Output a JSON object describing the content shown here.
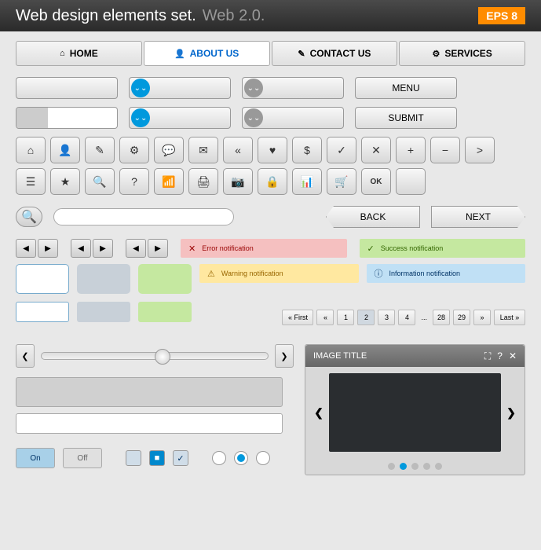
{
  "header": {
    "title": "Web design elements set.",
    "subtitle": "Web 2.0.",
    "badge": "EPS 8"
  },
  "nav": [
    {
      "icon": "⌂",
      "label": "HOME"
    },
    {
      "icon": "👤",
      "label": "ABOUT US",
      "active": true
    },
    {
      "icon": "✎",
      "label": "CONTACT US"
    },
    {
      "icon": "⚙",
      "label": "SERVICES"
    }
  ],
  "buttons": {
    "menu": "MENU",
    "submit": "SUBMIT",
    "back": "BACK",
    "next": "NEXT",
    "ok": "OK"
  },
  "icons": [
    "⌂",
    "👤",
    "✎",
    "⚙",
    "💬",
    "✉",
    "«",
    "♥",
    "$",
    "✓",
    "✕",
    "+",
    "−",
    ">",
    "☰",
    "★",
    "🔍",
    "?",
    "📶",
    "🖨",
    "📷",
    "🔒",
    "📊",
    "🛒"
  ],
  "notifications": {
    "error": "Error notification",
    "success": "Success notification",
    "warning": "Warning notification",
    "info": "Information notification"
  },
  "pagination": {
    "first": "« First",
    "prev": "«",
    "pages": [
      "1",
      "2",
      "3",
      "4"
    ],
    "more": "...",
    "end_pages": [
      "28",
      "29"
    ],
    "next": "»",
    "last": "Last »"
  },
  "toggle": {
    "on": "On",
    "off": "Off"
  },
  "image_panel": {
    "title": "IMAGE TITLE"
  }
}
